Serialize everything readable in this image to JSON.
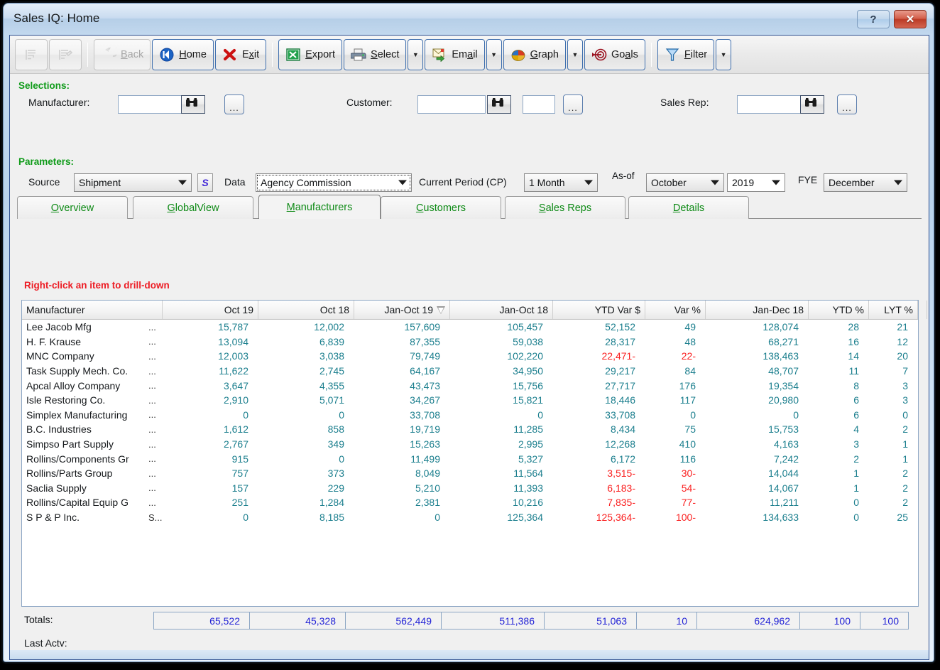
{
  "window": {
    "title": "Sales IQ: Home",
    "help_label": "?",
    "close_label": "✕"
  },
  "toolbar": {
    "buttons": [
      {
        "name": "list-view-1",
        "label": "",
        "icon": "list-lines-icon",
        "disabled": true
      },
      {
        "name": "list-view-2",
        "label": "",
        "icon": "list-lines-edit-icon",
        "disabled": true
      },
      {
        "name": "back",
        "label": "Back",
        "accesskey": "B",
        "icon": "back-arrow-icon",
        "disabled": true
      },
      {
        "name": "home",
        "label": "Home",
        "accesskey": "H",
        "icon": "home-icon",
        "disabled": false
      },
      {
        "name": "exit",
        "label": "Exit",
        "accesskey": "x",
        "icon": "red-x-icon",
        "disabled": false
      },
      {
        "name": "export",
        "label": "Export",
        "accesskey": "E",
        "icon": "excel-icon",
        "disabled": false
      },
      {
        "name": "select",
        "label": "Select",
        "accesskey": "S",
        "icon": "printer-icon",
        "disabled": false
      },
      {
        "name": "email",
        "label": "Email",
        "accesskey": "a",
        "icon": "email-icon",
        "disabled": false
      },
      {
        "name": "graph",
        "label": "Graph",
        "accesskey": "G",
        "icon": "pie-chart-icon",
        "disabled": false
      },
      {
        "name": "goals",
        "label": "Goals",
        "accesskey": "a",
        "icon": "target-icon",
        "disabled": false
      },
      {
        "name": "filter",
        "label": "Filter",
        "accesskey": "F",
        "icon": "funnel-icon",
        "disabled": false
      }
    ]
  },
  "selections": {
    "heading": "Selections:",
    "manufacturer_label": "Manufacturer:",
    "manufacturer_value": "",
    "customer_label": "Customer:",
    "customer_value": "",
    "customer_value2": "",
    "salesrep_label": "Sales Rep:",
    "salesrep_value": "",
    "browse_icon": "binoculars-icon",
    "more_label": "..."
  },
  "parameters": {
    "heading": "Parameters:",
    "source_label": "Source",
    "source_value": "Shipment",
    "s_button_label": "S",
    "data_label": "Data",
    "data_value": "Agency Commission",
    "cp_label": "Current Period (CP)",
    "cp_value": "1 Month",
    "asof_label": "As-of",
    "asof_month": "October",
    "asof_year": "2019",
    "fye_label": "FYE",
    "fye_value": "December"
  },
  "tabs": [
    {
      "label": "Overview",
      "accesskey": "O",
      "active": false
    },
    {
      "label": "GlobalView",
      "accesskey": "G",
      "active": false
    },
    {
      "label": "Manufacturers",
      "accesskey": "M",
      "active": true
    },
    {
      "label": "Customers",
      "accesskey": "C",
      "active": false
    },
    {
      "label": "Sales Reps",
      "accesskey": "S",
      "active": false
    },
    {
      "label": "Details",
      "accesskey": "D",
      "active": false
    }
  ],
  "hint": "Right-click an item to drill-down",
  "grid": {
    "columns": [
      "Manufacturer",
      "Oct 19",
      "Oct 18",
      "Jan-Oct 19",
      "Jan-Oct 18",
      "YTD Var $",
      "Var %",
      "Jan-Dec 18",
      "YTD %",
      "LYT %"
    ],
    "sorted_column": "Jan-Oct 19",
    "sort_direction": "descending",
    "rows": [
      {
        "name": "Lee Jacob Mfg",
        "ell": "...",
        "v": [
          "15,787",
          "12,002",
          "157,609",
          "105,457",
          "52,152",
          "49",
          "128,074",
          "28",
          "21"
        ]
      },
      {
        "name": "H. F. Krause",
        "ell": "...",
        "v": [
          "13,094",
          "6,839",
          "87,355",
          "59,038",
          "28,317",
          "48",
          "68,271",
          "16",
          "12"
        ]
      },
      {
        "name": "MNC Company",
        "ell": "...",
        "v": [
          "12,003",
          "3,038",
          "79,749",
          "102,220",
          "22,471-",
          "22-",
          "138,463",
          "14",
          "20"
        ]
      },
      {
        "name": "Task Supply Mech. Co.",
        "ell": "...",
        "v": [
          "11,622",
          "2,745",
          "64,167",
          "34,950",
          "29,217",
          "84",
          "48,707",
          "11",
          "7"
        ]
      },
      {
        "name": "Apcal Alloy Company",
        "ell": "...",
        "v": [
          "3,647",
          "4,355",
          "43,473",
          "15,756",
          "27,717",
          "176",
          "19,354",
          "8",
          "3"
        ]
      },
      {
        "name": "Isle Restoring Co.",
        "ell": "...",
        "v": [
          "2,910",
          "5,071",
          "34,267",
          "15,821",
          "18,446",
          "117",
          "20,980",
          "6",
          "3"
        ]
      },
      {
        "name": "Simplex Manufacturing",
        "ell": "...",
        "v": [
          "0",
          "0",
          "33,708",
          "0",
          "33,708",
          "0",
          "0",
          "6",
          "0"
        ]
      },
      {
        "name": "B.C. Industries",
        "ell": "...",
        "v": [
          "1,612",
          "858",
          "19,719",
          "11,285",
          "8,434",
          "75",
          "15,753",
          "4",
          "2"
        ]
      },
      {
        "name": "Simpso Part Supply",
        "ell": "...",
        "v": [
          "2,767",
          "349",
          "15,263",
          "2,995",
          "12,268",
          "410",
          "4,163",
          "3",
          "1"
        ]
      },
      {
        "name": "Rollins/Components Gr",
        "ell": "...",
        "v": [
          "915",
          "0",
          "11,499",
          "5,327",
          "6,172",
          "116",
          "7,242",
          "2",
          "1"
        ]
      },
      {
        "name": "Rollins/Parts Group",
        "ell": "...",
        "v": [
          "757",
          "373",
          "8,049",
          "11,564",
          "3,515-",
          "30-",
          "14,044",
          "1",
          "2"
        ]
      },
      {
        "name": "Saclia Supply",
        "ell": "...",
        "v": [
          "157",
          "229",
          "5,210",
          "11,393",
          "6,183-",
          "54-",
          "14,067",
          "1",
          "2"
        ]
      },
      {
        "name": "Rollins/Capital Equip G",
        "ell": "...",
        "v": [
          "251",
          "1,284",
          "2,381",
          "10,216",
          "7,835-",
          "77-",
          "11,211",
          "0",
          "2"
        ]
      },
      {
        "name": "S P & P Inc.",
        "ell": "S...",
        "v": [
          "0",
          "8,185",
          "0",
          "125,364",
          "125,364-",
          "100-",
          "134,633",
          "0",
          "25"
        ]
      }
    ]
  },
  "totals": {
    "label": "Totals:",
    "values": [
      "65,522",
      "45,328",
      "562,449",
      "511,386",
      "51,063",
      "10",
      "624,962",
      "100",
      "100"
    ]
  },
  "last_activity": {
    "label": "Last Actv:",
    "value": ""
  },
  "colors": {
    "positive": "#1c7f8e",
    "negative": "#fa2020",
    "totals": "#2525d6",
    "heading_green": "#0f9b19",
    "tab_green": "#0e8a16",
    "hint_red": "#ed1c24"
  }
}
